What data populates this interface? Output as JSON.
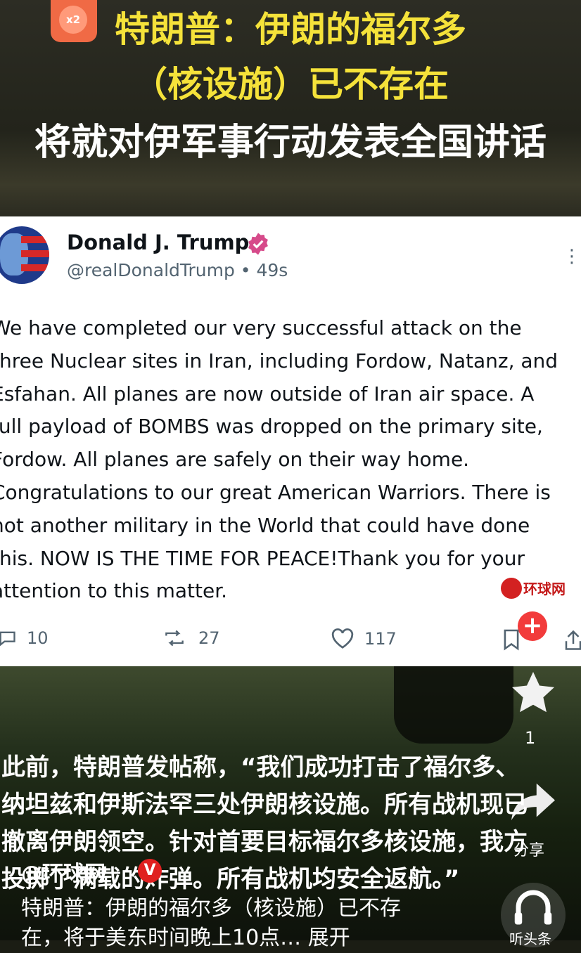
{
  "headline": {
    "line1": "特朗普：伊朗的福尔多",
    "line2": "（核设施）已不存在",
    "line3": "将就对伊军事行动发表全国讲话"
  },
  "badge": {
    "label": "x2"
  },
  "post": {
    "author_name": "Donald J. Trump",
    "handle_time": "@realDonaldTrump • 49s",
    "lines": [
      "We have completed our very successful attack on the",
      "three Nuclear sites in Iran, including Fordow, Natanz, and",
      "Esfahan. All planes are now outside of Iran air space. A",
      "full payload of BOMBS was dropped on the primary site,",
      "Fordow. All planes are safely on their way home.",
      "Congratulations to our great American Warriors. There is",
      "not another military in the World that could have done",
      "this. NOW IS THE TIME FOR PEACE!Thank you for your",
      "attention to this matter."
    ],
    "replies": "10",
    "reposts": "27",
    "likes": "117"
  },
  "watermark": {
    "text": "环球网"
  },
  "sidebar": {
    "like_count": "1",
    "share_label": "分享",
    "listen_label": "听头条"
  },
  "caption": "此前，特朗普发帖称，“我们成功打击了福尔多、\n纳坦兹和伊斯法罕三处伊朗核设施。所有战机现已\n撤离伊朗领空。针对首要目标福尔多核设施，我方\n投掷了满载的炸弹。所有战机均安全返航。”",
  "source": {
    "name": "@环球网",
    "v": "V"
  },
  "description": "特朗普：伊朗的福尔多（核设施）已不存\n在，将于美东时间晚上10点… 展开",
  "colors": {
    "headline_yellow": "#f5e23a",
    "accent_red": "#e02020",
    "text_dark": "#0f1419",
    "text_gray": "#536471"
  }
}
